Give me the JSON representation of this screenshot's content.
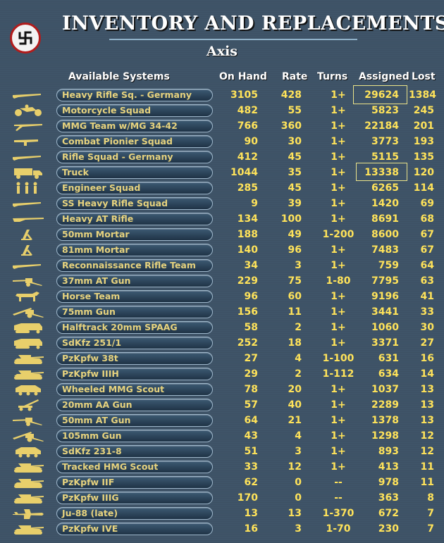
{
  "header": {
    "title": "INVENTORY AND REPLACEMENTS",
    "side": "Axis"
  },
  "columns": {
    "systems": "Available Systems",
    "on_hand": "On Hand",
    "rate": "Rate",
    "turns": "Turns",
    "assigned": "Assigned",
    "lost": "Lost"
  },
  "rows": [
    {
      "name": "Heavy Rifle Sq. - Germany",
      "icon": "rifle-icon",
      "on_hand": "3105",
      "rate": "428",
      "turns": "1+",
      "assigned": "29624",
      "lost": "1384"
    },
    {
      "name": "Motorcycle Squad",
      "icon": "motorcycle-icon",
      "on_hand": "482",
      "rate": "55",
      "turns": "1+",
      "assigned": "5823",
      "lost": "245"
    },
    {
      "name": "MMG Team w/MG 34-42",
      "icon": "machine-gun-icon",
      "on_hand": "766",
      "rate": "360",
      "turns": "1+",
      "assigned": "22184",
      "lost": "201"
    },
    {
      "name": "Combat Pionier Squad",
      "icon": "smg-icon",
      "on_hand": "90",
      "rate": "30",
      "turns": "1+",
      "assigned": "3773",
      "lost": "193"
    },
    {
      "name": "Rifle Squad - Germany",
      "icon": "rifle-icon",
      "on_hand": "412",
      "rate": "45",
      "turns": "1+",
      "assigned": "5115",
      "lost": "135"
    },
    {
      "name": "Truck",
      "icon": "truck-icon",
      "on_hand": "1044",
      "rate": "35",
      "turns": "1+",
      "assigned": "13338",
      "lost": "120"
    },
    {
      "name": "Engineer Squad",
      "icon": "soldiers-icon",
      "on_hand": "285",
      "rate": "45",
      "turns": "1+",
      "assigned": "6265",
      "lost": "114"
    },
    {
      "name": "SS Heavy Rifle Squad",
      "icon": "rifle-icon",
      "on_hand": "9",
      "rate": "39",
      "turns": "1+",
      "assigned": "1420",
      "lost": "69"
    },
    {
      "name": "Heavy AT Rifle",
      "icon": "at-rifle-icon",
      "on_hand": "134",
      "rate": "100",
      "turns": "1+",
      "assigned": "8691",
      "lost": "68"
    },
    {
      "name": "50mm Mortar",
      "icon": "mortar-icon",
      "on_hand": "188",
      "rate": "49",
      "turns": "1-200",
      "assigned": "8600",
      "lost": "67"
    },
    {
      "name": "81mm Mortar",
      "icon": "mortar-icon",
      "on_hand": "140",
      "rate": "96",
      "turns": "1+",
      "assigned": "7483",
      "lost": "67"
    },
    {
      "name": "Reconnaissance Rifle Team",
      "icon": "rifle-icon",
      "on_hand": "34",
      "rate": "3",
      "turns": "1+",
      "assigned": "759",
      "lost": "64"
    },
    {
      "name": "37mm AT Gun",
      "icon": "at-gun-icon",
      "on_hand": "229",
      "rate": "75",
      "turns": "1-80",
      "assigned": "7795",
      "lost": "63"
    },
    {
      "name": "Horse Team",
      "icon": "horse-icon",
      "on_hand": "96",
      "rate": "60",
      "turns": "1+",
      "assigned": "9196",
      "lost": "41"
    },
    {
      "name": "75mm Gun",
      "icon": "field-gun-icon",
      "on_hand": "156",
      "rate": "11",
      "turns": "1+",
      "assigned": "3441",
      "lost": "33"
    },
    {
      "name": "Halftrack 20mm SPAAG",
      "icon": "halftrack-icon",
      "on_hand": "58",
      "rate": "2",
      "turns": "1+",
      "assigned": "1060",
      "lost": "30"
    },
    {
      "name": "SdKfz 251/1",
      "icon": "halftrack-icon",
      "on_hand": "252",
      "rate": "18",
      "turns": "1+",
      "assigned": "3371",
      "lost": "27"
    },
    {
      "name": "PzKpfw 38t",
      "icon": "tank-icon",
      "on_hand": "27",
      "rate": "4",
      "turns": "1-100",
      "assigned": "631",
      "lost": "16"
    },
    {
      "name": "PzKpfw IIIH",
      "icon": "tank-icon",
      "on_hand": "29",
      "rate": "2",
      "turns": "1-112",
      "assigned": "634",
      "lost": "14"
    },
    {
      "name": "Wheeled MMG Scout",
      "icon": "armored-car-icon",
      "on_hand": "78",
      "rate": "20",
      "turns": "1+",
      "assigned": "1037",
      "lost": "13"
    },
    {
      "name": "20mm AA Gun",
      "icon": "aa-gun-icon",
      "on_hand": "57",
      "rate": "40",
      "turns": "1+",
      "assigned": "2289",
      "lost": "13"
    },
    {
      "name": "50mm AT Gun",
      "icon": "at-gun-icon",
      "on_hand": "64",
      "rate": "21",
      "turns": "1+",
      "assigned": "1378",
      "lost": "13"
    },
    {
      "name": "105mm Gun",
      "icon": "field-gun-icon",
      "on_hand": "43",
      "rate": "4",
      "turns": "1+",
      "assigned": "1298",
      "lost": "12"
    },
    {
      "name": "SdKfz 231-8",
      "icon": "armored-car-icon",
      "on_hand": "51",
      "rate": "3",
      "turns": "1+",
      "assigned": "893",
      "lost": "12"
    },
    {
      "name": "Tracked HMG Scout",
      "icon": "tank-icon",
      "on_hand": "33",
      "rate": "12",
      "turns": "1+",
      "assigned": "413",
      "lost": "11"
    },
    {
      "name": "PzKpfw IIF",
      "icon": "tank-icon",
      "on_hand": "62",
      "rate": "0",
      "turns": "--",
      "assigned": "978",
      "lost": "11"
    },
    {
      "name": "PzKpfw IIIG",
      "icon": "tank-icon",
      "on_hand": "170",
      "rate": "0",
      "turns": "--",
      "assigned": "363",
      "lost": "8"
    },
    {
      "name": "Ju-88 (late)",
      "icon": "aircraft-icon",
      "on_hand": "13",
      "rate": "13",
      "turns": "1-370",
      "assigned": "672",
      "lost": "7"
    },
    {
      "name": "PzKpfw IVE",
      "icon": "tank-icon",
      "on_hand": "16",
      "rate": "3",
      "turns": "1-70",
      "assigned": "230",
      "lost": "7"
    }
  ],
  "colors": {
    "background": "#3f5468",
    "value_text": "#ffe35a",
    "name_text": "#e7d37e",
    "icon_fill": "#e8cf6b",
    "highlight": "#ece48a"
  }
}
